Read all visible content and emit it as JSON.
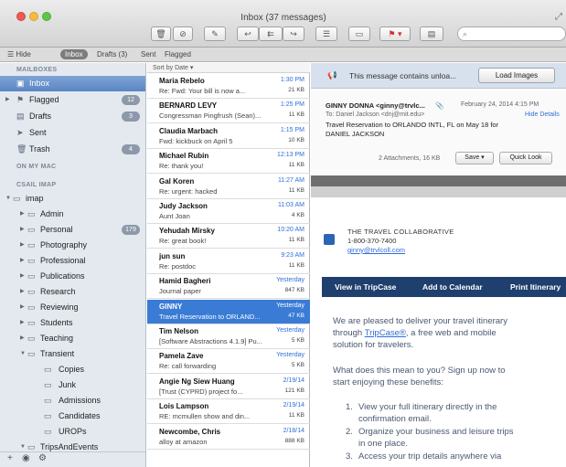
{
  "window": {
    "title": "Inbox (37 messages)"
  },
  "toolbar": {
    "search_placeholder": ""
  },
  "favorites": [
    {
      "label": "Hide",
      "selected": false
    },
    {
      "label": "Inbox",
      "selected": true
    },
    {
      "label": "Drafts (3)",
      "selected": false
    },
    {
      "label": "Sent",
      "selected": false
    },
    {
      "label": "Flagged",
      "selected": false
    }
  ],
  "sidebar": {
    "mailboxes_header": "MAILBOXES",
    "on_my_mac_header": "ON MY MAC",
    "account_header": "CSAIL IMAP",
    "mailboxes": [
      {
        "label": "Inbox",
        "icon": "inbox-icon",
        "badge": "",
        "selected": true
      },
      {
        "label": "Flagged",
        "icon": "flag-icon",
        "badge": "12",
        "selected": false
      },
      {
        "label": "Drafts",
        "icon": "drafts-icon",
        "badge": "3",
        "selected": false
      },
      {
        "label": "Sent",
        "icon": "sent-icon",
        "badge": "",
        "selected": false
      },
      {
        "label": "Trash",
        "icon": "trash-icon",
        "badge": "4",
        "selected": false
      }
    ],
    "folders": [
      {
        "label": "imap",
        "indent": 0,
        "badge": ""
      },
      {
        "label": "Admin",
        "indent": 1,
        "badge": ""
      },
      {
        "label": "Personal",
        "indent": 1,
        "badge": "179"
      },
      {
        "label": "Photography",
        "indent": 1,
        "badge": ""
      },
      {
        "label": "Professional",
        "indent": 1,
        "badge": ""
      },
      {
        "label": "Publications",
        "indent": 1,
        "badge": ""
      },
      {
        "label": "Research",
        "indent": 1,
        "badge": ""
      },
      {
        "label": "Reviewing",
        "indent": 1,
        "badge": ""
      },
      {
        "label": "Students",
        "indent": 1,
        "badge": ""
      },
      {
        "label": "Teaching",
        "indent": 1,
        "badge": ""
      },
      {
        "label": "Transient",
        "indent": 1,
        "badge": ""
      },
      {
        "label": "Copies",
        "indent": 2,
        "badge": ""
      },
      {
        "label": "Junk",
        "indent": 2,
        "badge": ""
      },
      {
        "label": "Admissions",
        "indent": 2,
        "badge": ""
      },
      {
        "label": "Candidates",
        "indent": 2,
        "badge": ""
      },
      {
        "label": "UROPs",
        "indent": 2,
        "badge": ""
      },
      {
        "label": "TripsAndEvents",
        "indent": 1,
        "badge": ""
      }
    ],
    "footer_add": "+",
    "footer_gear": "⚙"
  },
  "message_list": {
    "sort_label": "Sort by Date ▾",
    "messages": [
      {
        "from": "Maria Rebelo",
        "subject": "Re: Fwd: Your bill is now a...",
        "time": "1:30 PM",
        "size": "21 KB",
        "selected": false
      },
      {
        "from": "BERNARD LEVY",
        "subject": "Congressman Pingfrush (Sean)...",
        "time": "1:25 PM",
        "size": "11 KB",
        "selected": false
      },
      {
        "from": "Claudia Marbach",
        "subject": "Fwd: kickbuck on April 5",
        "time": "1:15 PM",
        "size": "10 KB",
        "selected": false
      },
      {
        "from": "Michael Rubin",
        "subject": "Re: thank you!",
        "time": "12:13 PM",
        "size": "11 KB",
        "selected": false
      },
      {
        "from": "Gal Koren",
        "subject": "Re: urgent: hacked",
        "time": "11:27 AM",
        "size": "11 KB",
        "selected": false
      },
      {
        "from": "Judy Jackson",
        "subject": "Aunt Joan",
        "time": "11:03 AM",
        "size": "4 KB",
        "selected": false
      },
      {
        "from": "Yehudah Mirsky",
        "subject": "Re: great book!",
        "time": "10:20 AM",
        "size": "11 KB",
        "selected": false
      },
      {
        "from": "jun sun",
        "subject": "Re: postdoc",
        "time": "9:23 AM",
        "size": "11 KB",
        "selected": false
      },
      {
        "from": "Hamid Bagheri",
        "subject": "Journal paper",
        "time": "Yesterday",
        "size": "847 KB",
        "selected": false
      },
      {
        "from": "GINNY",
        "subject": "Travel Reservation to ORLAND...",
        "time": "Yesterday",
        "size": "47 KB",
        "selected": true
      },
      {
        "from": "Tim Nelson",
        "subject": "[Software Abstractions 4.1.9] Pu...",
        "time": "Yesterday",
        "size": "5 KB",
        "selected": false
      },
      {
        "from": "Pamela Zave",
        "subject": "Re: call forwarding",
        "time": "Yesterday",
        "size": "5 KB",
        "selected": false
      },
      {
        "from": "Angie Ng Siew Huang",
        "subject": "[Trust (CYPRD) project fo...",
        "time": "2/19/14",
        "size": "121 KB",
        "selected": false
      },
      {
        "from": "Lois Lampson",
        "subject": "RE: mcmullen show and din...",
        "time": "2/19/14",
        "size": "11 KB",
        "selected": false
      },
      {
        "from": "Newcombe, Chris",
        "subject": "alloy at amazon",
        "time": "2/18/14",
        "size": "888 KB",
        "selected": false
      }
    ]
  },
  "reader": {
    "banner_text": "This message contains unloa...",
    "load_images_label": "Load Images",
    "from_line": "GINNY DONNA <ginny@trvlc...",
    "date_line": "February 24, 2014 4:15 PM",
    "to_line": "To: Daniel Jackson <dnj@mit.edu>",
    "hide_details": "Hide Details",
    "subject_line_1": "Travel Reservation to ORLANDO INTL, FL on May 18 for",
    "subject_line_2": "DANIEL JACKSON",
    "attachments": "2 Attachments, 16 KB",
    "save_label": "Save ▾",
    "quicklook_label": "Quick Look",
    "company": "THE TRAVEL COLLABORATIVE",
    "phone": "1-800-370-7400",
    "email": "ginny@trvlcoll.com",
    "nav_items": [
      "View in TripCase",
      "Add to Calendar",
      "Print Itinerary"
    ],
    "para1_line1": "We are pleased to deliver your travel itinerary",
    "para1_line2_a": "through ",
    "para1_link": "TripCase®",
    "para1_line2_b": ", a free web and mobile",
    "para1_line3": "solution for travelers.",
    "para2_line1": "What does this mean to you? Sign up now to",
    "para2_line2": "start enjoying these benefits:",
    "list": [
      {
        "num": "1.",
        "l1": "View your full itinerary directly in the",
        "l2": "confirmation email."
      },
      {
        "num": "2.",
        "l1": "Organize your business and leisure trips",
        "l2": "in one place."
      },
      {
        "num": "3.",
        "l1": "Access your trip details anywhere via",
        "l2": ""
      }
    ]
  },
  "colors": {
    "selection": "#3a7bd5",
    "sidebar_bg": "#e4e9ef",
    "nav_bar": "#1f3f6e",
    "link": "#2f6fd6"
  }
}
